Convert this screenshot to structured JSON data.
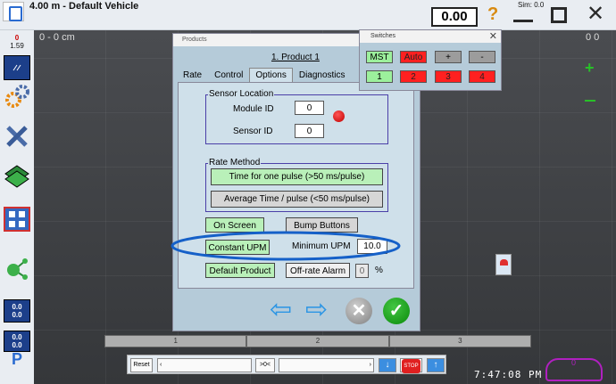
{
  "window": {
    "title": "4.00 m - Default Vehicle",
    "speed": "0.00",
    "help": "?",
    "sim": "Sim: 0.0"
  },
  "sidebar": {
    "top_value": "0",
    "second_value": "1.59",
    "box1": "0.0\n0.0",
    "box2": "0.0\n0.0"
  },
  "field": {
    "grid_label_left": "0 - 0 cm",
    "grid_label_right": "0 0"
  },
  "products_dialog": {
    "title": "Products",
    "product_name": "1. Product 1",
    "tabs": [
      "Rate",
      "Control",
      "Options",
      "Diagnostics"
    ],
    "sensor_location": {
      "label": "Sensor Location",
      "module_label": "Module ID",
      "module_value": "0",
      "sensor_label": "Sensor ID",
      "sensor_value": "0"
    },
    "rate_method": {
      "label": "Rate Method",
      "option1": "Time for one pulse (>50 ms/pulse)",
      "option2": "Average Time / pulse (<50 ms/pulse)"
    },
    "on_screen": "On Screen",
    "bump_buttons": "Bump Buttons",
    "constant_upm": "Constant UPM",
    "minimum_upm_label": "Minimum UPM",
    "minimum_upm_value": "10.0",
    "default_product": "Default Product",
    "offrate_label": "Off-rate Alarm",
    "offrate_value": "0",
    "percent": "%"
  },
  "switches": {
    "title": "Switches",
    "close": "✕",
    "mst": "MST",
    "auto": "Auto",
    "plus": "+",
    "minus": "-",
    "s1": "1",
    "s2": "2",
    "s3": "3",
    "s4": "4"
  },
  "sections": [
    "1",
    "2",
    "3"
  ],
  "bottombar": {
    "reset": "Reset",
    "center": ">0<",
    "stop": "STOP"
  },
  "clock": "7:47:08 PM",
  "compass": "0"
}
